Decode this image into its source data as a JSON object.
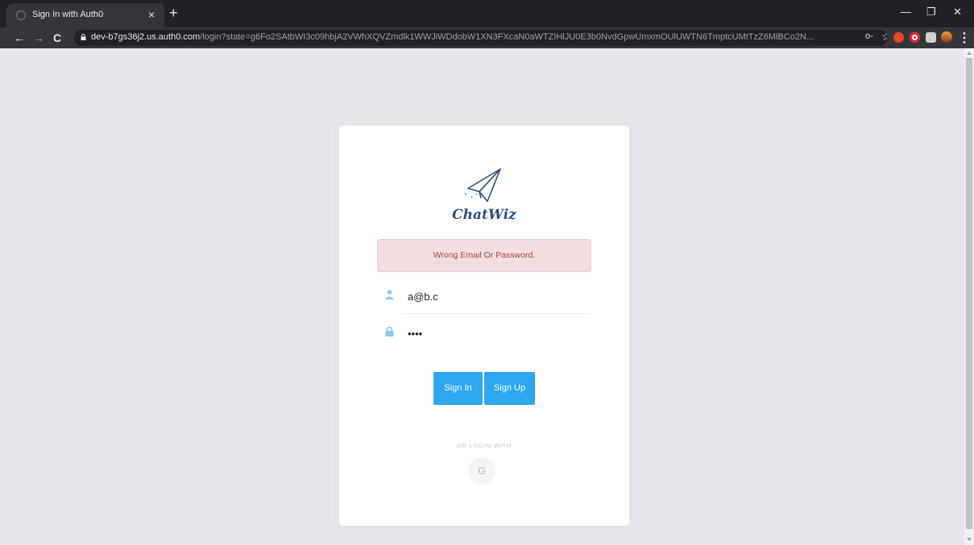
{
  "browser": {
    "tab_title": "Sign In with Auth0",
    "tab_close": "×",
    "new_tab": "+",
    "url_host": "dev-b7gs36j2.us.auth0.com",
    "url_path": "/login?state=g6Fo2SAtbWI3c09hbjA2VWhXQVZmdlk1WWJiWDdobW1XN3FXcaN0aWTZIHlJU0E3b0NvdGpwUmxmOUlUWTN6TmptcUMtTzZ6MlBCo2N...",
    "nav": {
      "back": "←",
      "forward": "→",
      "reload": "C"
    },
    "window_controls": {
      "minimize": "—",
      "restore": "❐",
      "close": "✕"
    },
    "omnibox_icons": {
      "key": "o-",
      "star": "☆"
    },
    "menu": "⋮"
  },
  "app": {
    "logo_text": "ChatWiz",
    "error_message": "Wrong Email Or Password.",
    "email_value": "a@b.c",
    "password_value": "••••",
    "sign_in_label": "Sign In",
    "sign_up_label": "Sign Up",
    "or_login_with": "OR LOGIN WITH",
    "google_label": "G"
  },
  "icons": {
    "email": "user-icon",
    "password": "lock-icon",
    "logo": "paper-plane-icon"
  },
  "colors": {
    "accent": "#2ea7f0",
    "alert_bg": "#f2dede",
    "alert_text": "#a94442",
    "logo": "#2f4f7a",
    "field_icon": "#8fc8ec"
  }
}
